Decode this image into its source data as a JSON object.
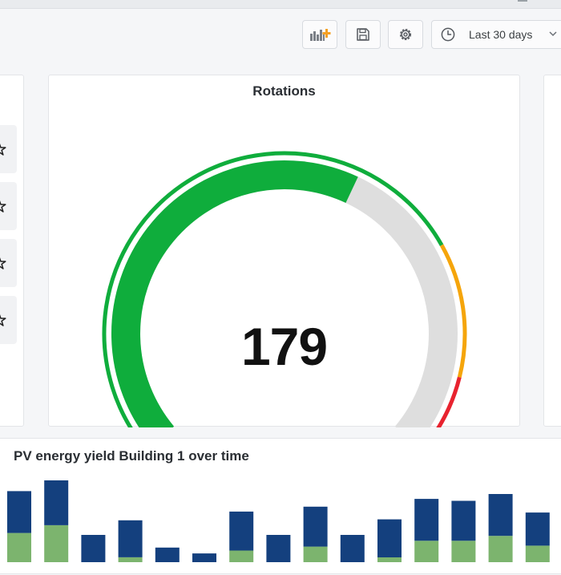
{
  "toolbar": {
    "add_panel_icon": "add-panel-icon",
    "save_icon": "save-icon",
    "settings_icon": "gear-icon",
    "time_range": {
      "icon": "clock-icon",
      "label": "Last 30 days"
    }
  },
  "left_panel": {
    "items": [
      "star-icon",
      "star-icon",
      "star-icon",
      "star-icon"
    ]
  },
  "gauge_panel": {
    "title": "Rotations",
    "value": "179",
    "value_number": 179,
    "min": 0,
    "max": 300,
    "thresholds": [
      {
        "from": 0,
        "to": 220,
        "color": "#0fad3c"
      },
      {
        "from": 220,
        "to": 270,
        "color": "#f5a50b"
      },
      {
        "from": 270,
        "to": 300,
        "color": "#e8232f"
      }
    ],
    "fill_color": "#0fad3c",
    "track_color": "#dedede"
  },
  "bar_panel": {
    "title": "PV energy yield Building 1 over time",
    "chart_data": {
      "type": "bar",
      "stacked": true,
      "visible_range": [
        0,
        70
      ],
      "series": [
        {
          "color": "#7cb46e",
          "values": [
            30,
            38,
            0,
            5,
            0,
            0,
            12,
            0,
            16,
            0,
            5,
            22,
            22,
            27,
            17
          ]
        },
        {
          "color": "#14407e",
          "values": [
            43,
            46,
            28,
            38,
            15,
            9,
            40,
            28,
            41,
            28,
            39,
            43,
            41,
            43,
            34
          ]
        }
      ]
    }
  }
}
